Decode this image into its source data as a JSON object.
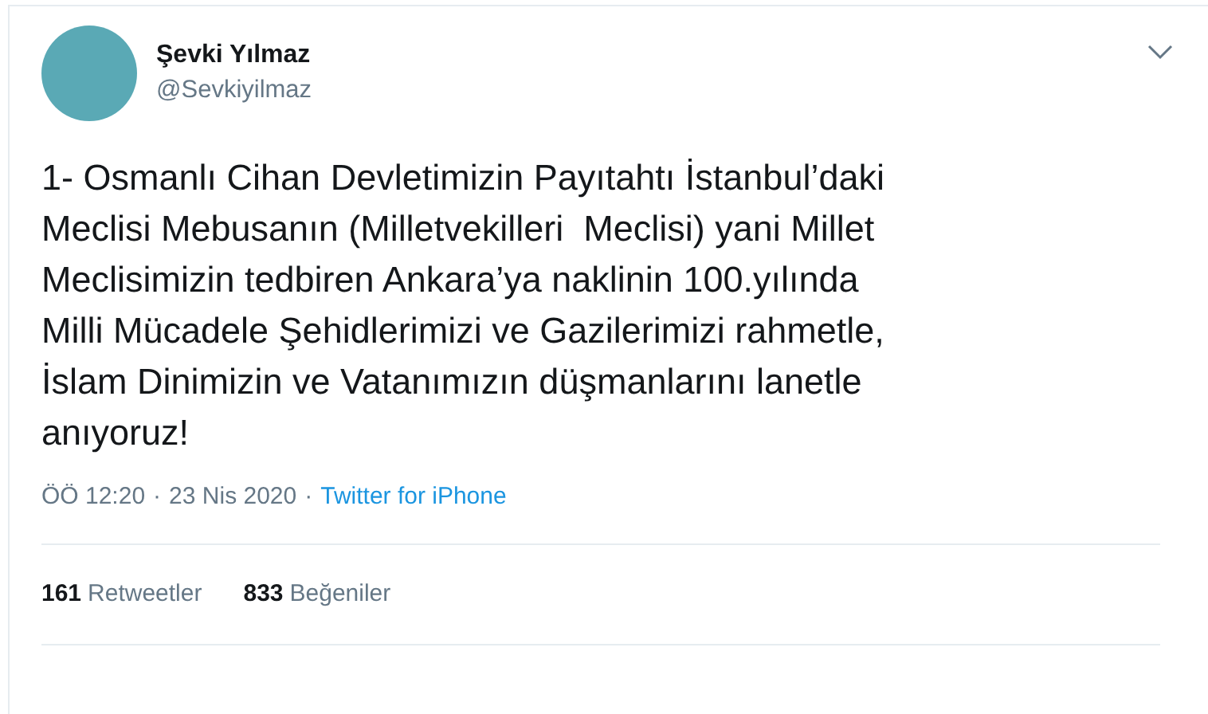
{
  "author": {
    "name": "Şevki Yılmaz",
    "handle": "@Sevkiyilmaz"
  },
  "tweet": {
    "text": "1- Osmanlı Cihan Devletimizin Payıtahtı İstanbul’daki\nMeclisi Mebusanın (Milletvekilleri  Meclisi) yani Millet\nMeclisimizin tedbiren Ankara’ya naklinin 100.yılında\nMilli Mücadele Şehidlerimizi ve Gazilerimizi rahmetle,\nİslam Dinimizin ve Vatanımızın düşmanlarını lanetle\nanıyoruz!"
  },
  "meta": {
    "time": "ÖÖ 12:20",
    "separator_1": "·",
    "date": "23 Nis 2020",
    "separator_2": "·",
    "source": "Twitter for iPhone"
  },
  "stats": [
    {
      "count": "161",
      "label": "Retweetler"
    },
    {
      "count": "833",
      "label": "Beğeniler"
    }
  ]
}
